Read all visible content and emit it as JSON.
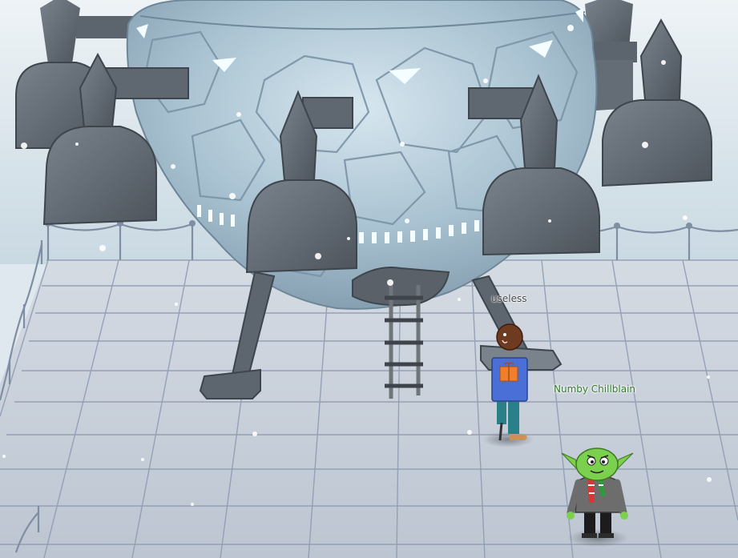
{
  "colors": {
    "sky_top": "#eef3f6",
    "sky_bottom": "#c9d9e2",
    "floor": "#c7cfd9",
    "floor_grid": "#8e9cb2",
    "hull": "#9fb6c6",
    "thruster": "#5f6770",
    "glow": "#e8fbff",
    "player_label": "#4a4a4a",
    "npc_label": "#2f7a2c"
  },
  "scene": {
    "setting": "icy rooftop platform",
    "ship": "domed spacecraft with thrusters and landing legs",
    "ladder": "ladder-icon"
  },
  "characters": [
    {
      "id": "player",
      "name": "useless",
      "icon": "avatar-icon"
    },
    {
      "id": "npc",
      "name": "Numby Chillblain",
      "icon": "goblin-icon"
    }
  ]
}
